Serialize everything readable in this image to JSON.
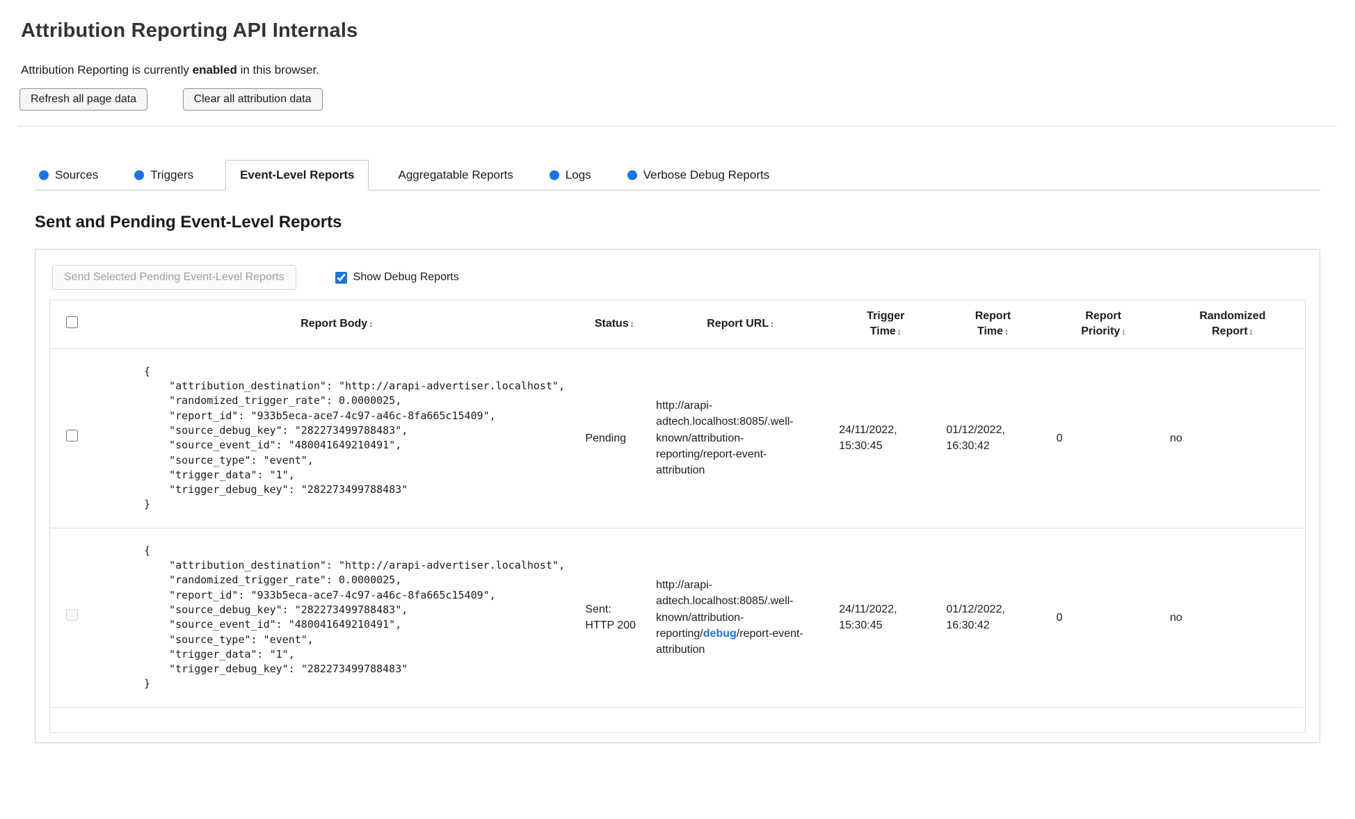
{
  "page": {
    "title": "Attribution Reporting API Internals",
    "status_prefix": "Attribution Reporting is currently ",
    "status_bold": "enabled",
    "status_suffix": " in this browser.",
    "refresh_button": "Refresh all page data",
    "clear_button": "Clear all attribution data"
  },
  "tabs": [
    {
      "label": "Sources"
    },
    {
      "label": "Triggers"
    },
    {
      "label": "Event-Level Reports"
    },
    {
      "label": "Aggregatable Reports"
    },
    {
      "label": "Logs"
    },
    {
      "label": "Verbose Debug Reports"
    }
  ],
  "section": {
    "heading": "Sent and Pending Event-Level Reports",
    "send_button_label": "Send Selected Pending Event-Level Reports",
    "show_debug_label": "Show Debug Reports",
    "show_debug_checked": true
  },
  "table": {
    "sort_icon": "↕",
    "headers": {
      "report_body": "Report Body",
      "status": "Status",
      "report_url": "Report URL",
      "trigger_time": "Trigger Time",
      "report_time": "Report Time",
      "report_priority": "Report Priority",
      "randomized_report": "Randomized Report"
    },
    "rows": [
      {
        "body": "{\n    \"attribution_destination\": \"http://arapi-advertiser.localhost\",\n    \"randomized_trigger_rate\": 0.0000025,\n    \"report_id\": \"933b5eca-ace7-4c97-a46c-8fa665c15409\",\n    \"source_debug_key\": \"282273499788483\",\n    \"source_event_id\": \"480041649210491\",\n    \"source_type\": \"event\",\n    \"trigger_data\": \"1\",\n    \"trigger_debug_key\": \"282273499788483\"\n}",
        "status": "Pending",
        "url_prefix": "http://arapi-adtech.localhost:8085/.well-known/attribution-reporting/report-event-attribution",
        "url_debug": "",
        "url_suffix": "",
        "trigger_time": "24/11/2022, 15:30:45",
        "report_time": "01/12/2022, 16:30:42",
        "report_priority": "0",
        "randomized_report": "no",
        "checkbox_disabled": false
      },
      {
        "body": "{\n    \"attribution_destination\": \"http://arapi-advertiser.localhost\",\n    \"randomized_trigger_rate\": 0.0000025,\n    \"report_id\": \"933b5eca-ace7-4c97-a46c-8fa665c15409\",\n    \"source_debug_key\": \"282273499788483\",\n    \"source_event_id\": \"480041649210491\",\n    \"source_type\": \"event\",\n    \"trigger_data\": \"1\",\n    \"trigger_debug_key\": \"282273499788483\"\n}",
        "status": "Sent: HTTP 200",
        "url_prefix": "http://arapi-adtech.localhost:8085/.well-known/attribution-reporting/",
        "url_debug": "debug",
        "url_suffix": "/report-event-attribution",
        "trigger_time": "24/11/2022, 15:30:45",
        "report_time": "01/12/2022, 16:30:42",
        "report_priority": "0",
        "randomized_report": "no",
        "checkbox_disabled": true
      }
    ]
  },
  "colors": {
    "accent_blue": "#1a73e8",
    "debug_highlight": "#1a73e8"
  }
}
